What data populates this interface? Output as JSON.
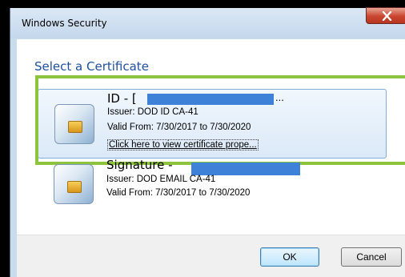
{
  "window": {
    "title": "Windows Security"
  },
  "dialog": {
    "heading": "Select a Certificate",
    "certificates": [
      {
        "name": "ID - [",
        "trailing": "...",
        "issuer": "Issuer: DOD ID CA-41",
        "valid": "Valid From: 7/30/2017 to 7/30/2020",
        "link": "Click here to view certificate prope..."
      },
      {
        "name": "Signature -",
        "issuer": "Issuer: DOD EMAIL CA-41",
        "valid": "Valid From: 7/30/2017 to 7/30/2020"
      }
    ]
  },
  "buttons": {
    "ok": "OK",
    "cancel": "Cancel"
  },
  "colors": {
    "highlight": "#8dc33d",
    "redaction": "#3d82d8",
    "heading": "#1f4f9e"
  }
}
